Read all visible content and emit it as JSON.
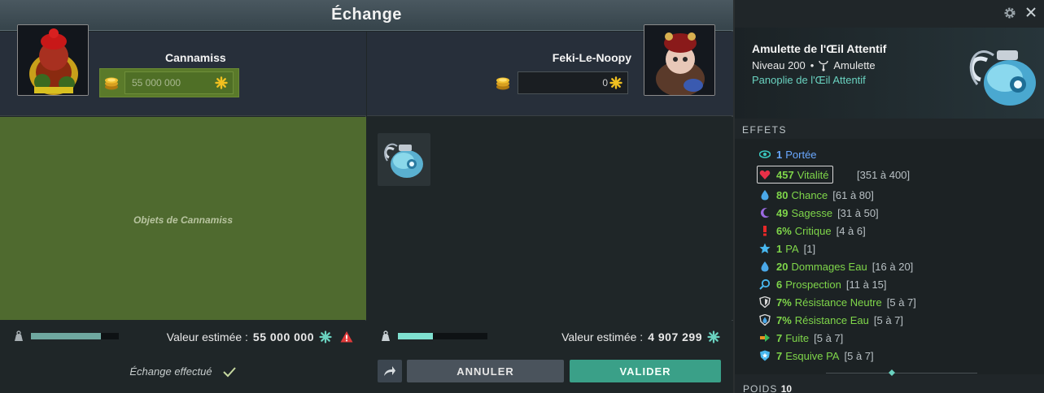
{
  "exchange": {
    "title": "Échange",
    "left": {
      "player_name": "Cannamiss",
      "kamas_value": "55 000 000",
      "items_placeholder": "Objets de Cannamiss",
      "valeur_label": "Valeur estimée :",
      "valeur_value": "55 000 000",
      "status_text": "Échange effectué",
      "weight_fraction": 0.8
    },
    "right": {
      "player_name": "Feki-Le-Noopy",
      "kamas_value": "0",
      "valeur_label": "Valeur estimée :",
      "valeur_value": "4 907 299",
      "weight_fraction": 0.39,
      "annuler_label": "ANNULER",
      "valider_label": "VALIDER"
    }
  },
  "tooltip": {
    "item_name": "Amulette de l'Œil Attentif",
    "level_text": "Niveau 200",
    "separator": "•",
    "type_text": "Amulette",
    "set_name": "Panoplie de l'Œil Attentif",
    "effets_title": "EFFETS",
    "effects": [
      {
        "value": "1",
        "name": "Portée",
        "range": "",
        "icon": "eye-icon"
      },
      {
        "value": "457",
        "name": "Vitalité",
        "range": "[351 à 400]",
        "icon": "heart-icon"
      },
      {
        "value": "80",
        "name": "Chance",
        "range": "[61 à 80]",
        "icon": "water-drop-icon"
      },
      {
        "value": "49",
        "name": "Sagesse",
        "range": "[31 à 50]",
        "icon": "moon-icon"
      },
      {
        "value": "6%",
        "name": "Critique",
        "range": "[4 à 6]",
        "icon": "exclamation-icon"
      },
      {
        "value": "1",
        "name": "PA",
        "range": "[1]",
        "icon": "star-icon"
      },
      {
        "value": "20",
        "name": "Dommages Eau",
        "range": "[16 à 20]",
        "icon": "water-drop-icon"
      },
      {
        "value": "6",
        "name": "Prospection",
        "range": "[11 à 15]",
        "icon": "magnifier-icon"
      },
      {
        "value": "7%",
        "name": "Résistance Neutre",
        "range": "[5 à 7]",
        "icon": "shield-neutral-icon"
      },
      {
        "value": "7%",
        "name": "Résistance Eau",
        "range": "[5 à 7]",
        "icon": "shield-water-icon"
      },
      {
        "value": "7",
        "name": "Fuite",
        "range": "[5 à 7]",
        "icon": "flee-icon"
      },
      {
        "value": "7",
        "name": "Esquive PA",
        "range": "[5 à 7]",
        "icon": "shield-star-icon"
      }
    ],
    "poids_label": "POIDS",
    "poids_value": "10"
  },
  "colors": {
    "accent_green": "#3aa088",
    "stat_green": "#7fd64a",
    "stat_blue": "#6aa8ff",
    "set_teal": "#6ad2c0",
    "left_pane_bg": "#4f6a2f"
  }
}
